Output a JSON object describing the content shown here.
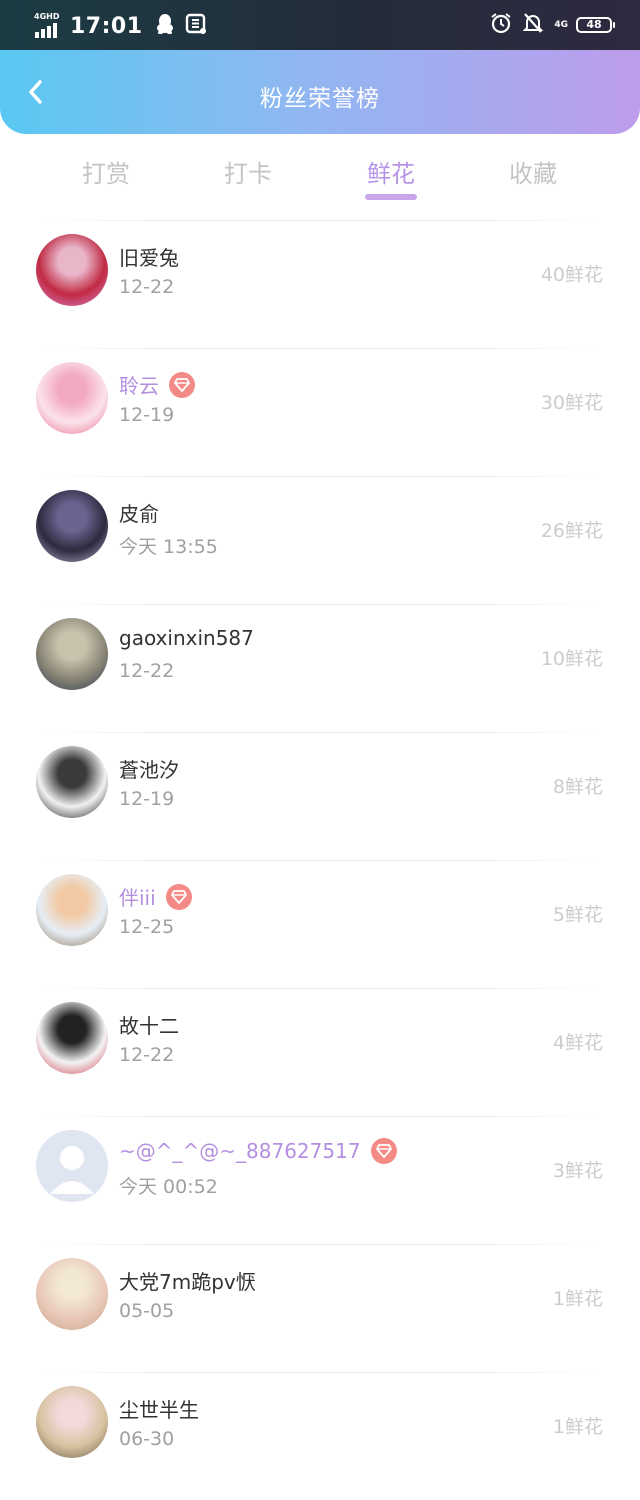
{
  "status_bar": {
    "network_label": "4GHD",
    "time": "17:01",
    "right_network": "4G",
    "battery": "48"
  },
  "header": {
    "title": "粉丝荣誉榜"
  },
  "tabs": [
    {
      "label": "打赏",
      "active": false
    },
    {
      "label": "打卡",
      "active": false
    },
    {
      "label": "鲜花",
      "active": true
    },
    {
      "label": "收藏",
      "active": false
    }
  ],
  "fans": [
    {
      "name": "旧爱兔",
      "date": "12-22",
      "count": "40鲜花",
      "vip": false,
      "avatar_colors": [
        "#c12a42",
        "#e8b5c9",
        "#d889d8"
      ]
    },
    {
      "name": "聆云",
      "date": "12-19",
      "count": "30鲜花",
      "vip": true,
      "avatar_colors": [
        "#fbe3ea",
        "#f3a9c0",
        "#e86a8e"
      ]
    },
    {
      "name": "皮俞",
      "date": "今天 13:55",
      "count": "26鲜花",
      "vip": false,
      "avatar_colors": [
        "#2d2a3e",
        "#6a6590",
        "#b7b2cf"
      ]
    },
    {
      "name": "gaoxinxin587",
      "date": "12-22",
      "count": "10鲜花",
      "vip": false,
      "avatar_colors": [
        "#8a8676",
        "#c9c2ad",
        "#2a3a52"
      ]
    },
    {
      "name": "蒼池汐",
      "date": "12-19",
      "count": "8鲜花",
      "vip": false,
      "avatar_colors": [
        "#f1f1f1",
        "#3a3a3a",
        "#111111"
      ]
    },
    {
      "name": "伴iii",
      "date": "12-25",
      "count": "5鲜花",
      "vip": true,
      "avatar_colors": [
        "#e6eef6",
        "#f2c9a3",
        "#8a6f55"
      ]
    },
    {
      "name": "故十二",
      "date": "12-22",
      "count": "4鲜花",
      "vip": false,
      "avatar_colors": [
        "#f3f3f3",
        "#222222",
        "#c73c4a"
      ]
    },
    {
      "name": "~@^_^@~_887627517",
      "date": "今天 00:52",
      "count": "3鲜花",
      "vip": true,
      "avatar_colors": [
        "#dfe5f1",
        "#ffffff",
        "#c8d1e5"
      ]
    },
    {
      "name": "大党7m跪pv恹",
      "date": "05-05",
      "count": "1鲜花",
      "vip": false,
      "avatar_colors": [
        "#e9c8b8",
        "#f2e8d4",
        "#caa28a"
      ]
    },
    {
      "name": "尘世半生",
      "date": "06-30",
      "count": "1鲜花",
      "vip": false,
      "avatar_colors": [
        "#d7c2a0",
        "#f3d9da",
        "#6b5a48"
      ]
    }
  ]
}
